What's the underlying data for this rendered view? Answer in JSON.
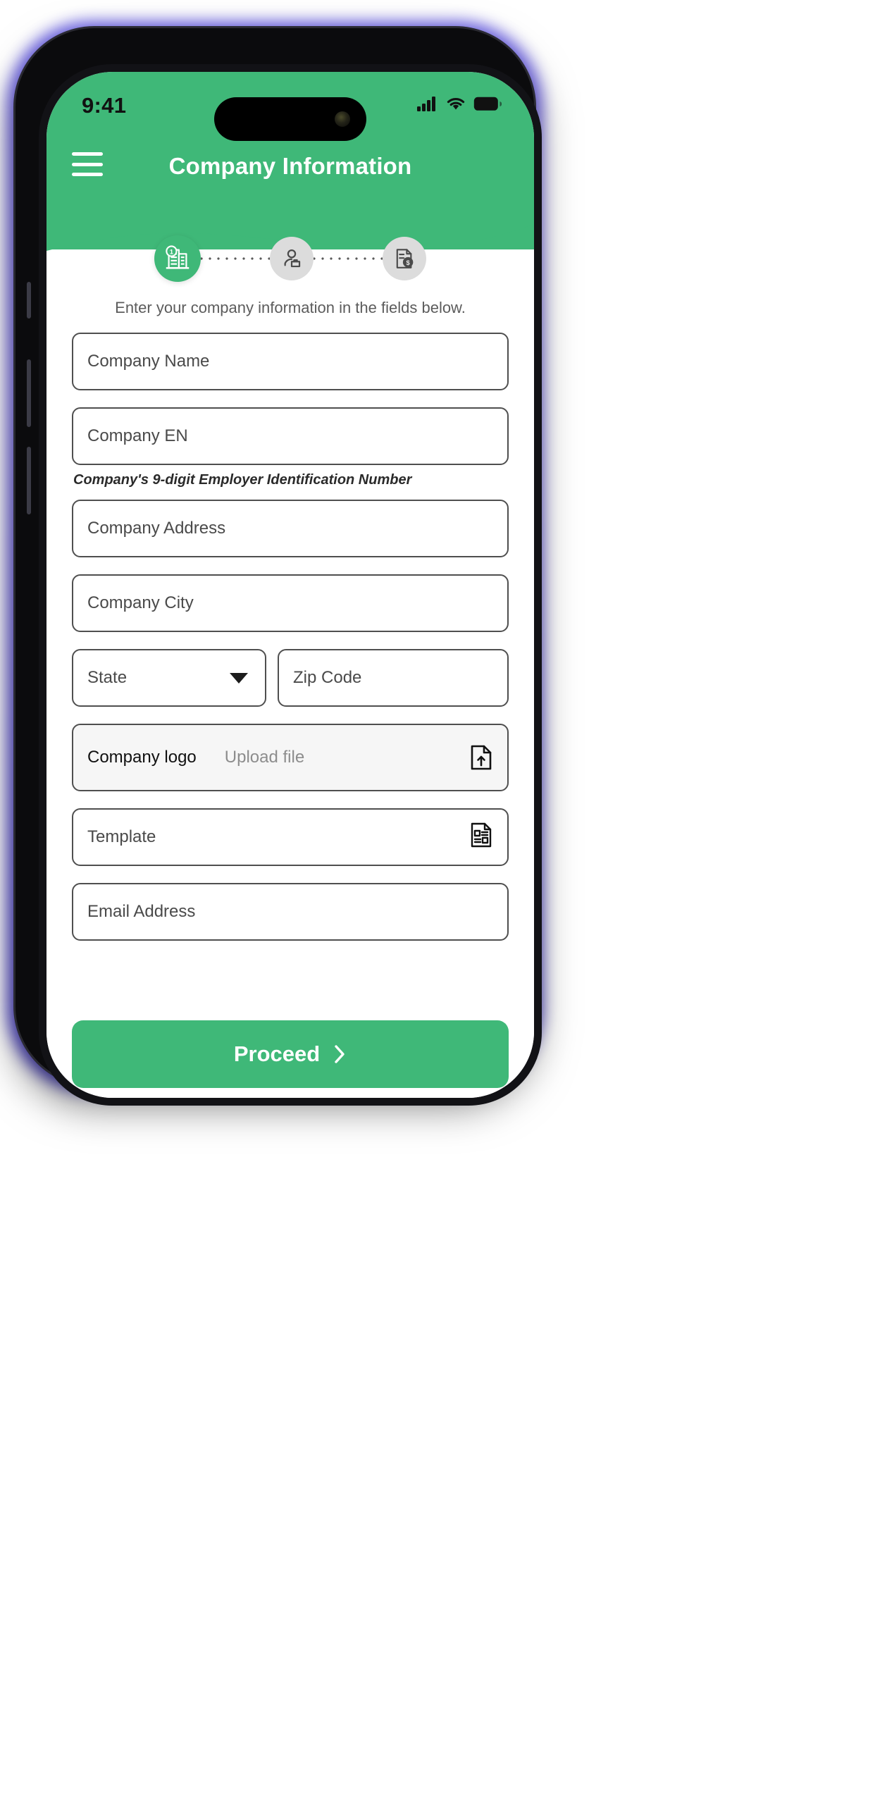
{
  "theme": {
    "brand_green": "#3fb878",
    "frame_black": "#0b0b0d",
    "glow_purple": "#6d63f0",
    "field_border": "#4f4f4f",
    "upload_bg": "#f6f6f6",
    "step_inactive": "#dcdcdc"
  },
  "status_bar": {
    "time": "9:41",
    "icons": [
      "cellular-signal-icon",
      "wifi-icon",
      "battery-icon"
    ]
  },
  "navbar": {
    "menu_icon": "hamburger-menu-icon",
    "title": "Company Information"
  },
  "stepper": {
    "steps": [
      {
        "id": "company",
        "icon": "company-building-icon",
        "state": "active",
        "number": "1"
      },
      {
        "id": "employee",
        "icon": "employee-person-icon",
        "state": "inactive"
      },
      {
        "id": "tax",
        "icon": "tax-document-icon",
        "state": "inactive"
      }
    ]
  },
  "main": {
    "instruction": "Enter your company information in the fields below.",
    "fields": [
      {
        "name": "company-name",
        "placeholder": "Company Name",
        "value": ""
      },
      {
        "name": "company-en",
        "placeholder": "Company EN",
        "value": ""
      }
    ],
    "ein_helper": "Company's 9-digit Employer Identification Number",
    "address_placeholder": "Company Address",
    "city_placeholder": "Company City",
    "state_placeholder": "State",
    "state_caret_icon": "chevron-down-icon",
    "zip_placeholder": "Zip Code",
    "logo_label": "Company logo",
    "logo_action": "Upload file",
    "logo_icon": "upload-file-icon",
    "template_placeholder": "Template",
    "template_icon": "document-template-icon",
    "email_placeholder": "Email Address"
  },
  "footer": {
    "proceed_label": "Proceed",
    "proceed_icon": "chevron-right-icon"
  }
}
